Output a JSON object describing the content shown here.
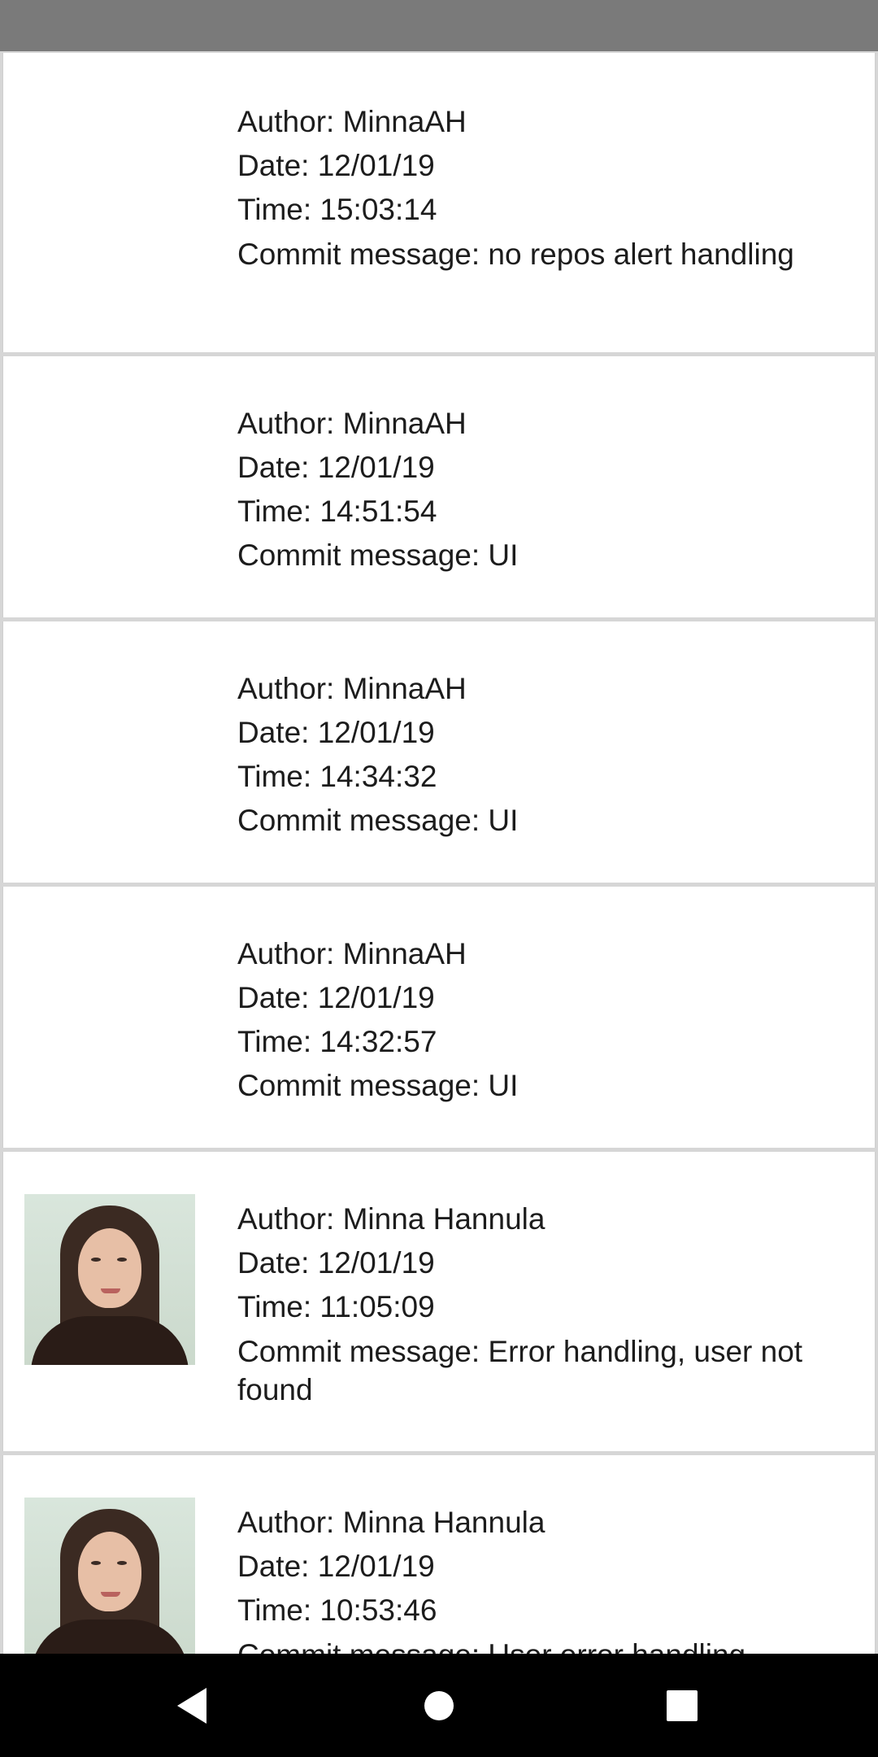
{
  "commits": [
    {
      "author_label": "Author: MinnaAH",
      "date_label": "Date: 12/01/19",
      "time_label": "Time: 15:03:14",
      "message_label": "Commit message: no repos alert handling",
      "has_avatar": false
    },
    {
      "author_label": "Author: MinnaAH",
      "date_label": "Date: 12/01/19",
      "time_label": "Time: 14:51:54",
      "message_label": "Commit message: UI",
      "has_avatar": false
    },
    {
      "author_label": "Author: MinnaAH",
      "date_label": "Date: 12/01/19",
      "time_label": "Time: 14:34:32",
      "message_label": "Commit message: UI",
      "has_avatar": false
    },
    {
      "author_label": "Author: MinnaAH",
      "date_label": "Date: 12/01/19",
      "time_label": "Time: 14:32:57",
      "message_label": "Commit message: UI",
      "has_avatar": false
    },
    {
      "author_label": "Author: Minna Hannula",
      "date_label": "Date: 12/01/19",
      "time_label": "Time: 11:05:09",
      "message_label": "Commit message: Error handling, user not found",
      "has_avatar": true
    },
    {
      "author_label": "Author: Minna Hannula",
      "date_label": "Date: 12/01/19",
      "time_label": "Time: 10:53:46",
      "message_label": "Commit message: User error handling",
      "has_avatar": true
    }
  ],
  "navigation": {
    "back_icon": "triangle-back-icon",
    "home_icon": "circle-home-icon",
    "recents_icon": "square-recents-icon"
  },
  "colors": {
    "status_bar": "#7a7a7a",
    "nav_bar": "#000000",
    "card_background": "#ffffff",
    "divider": "#d6d6d6",
    "text": "#1c1c1c",
    "nav_icon": "#ffffff"
  }
}
